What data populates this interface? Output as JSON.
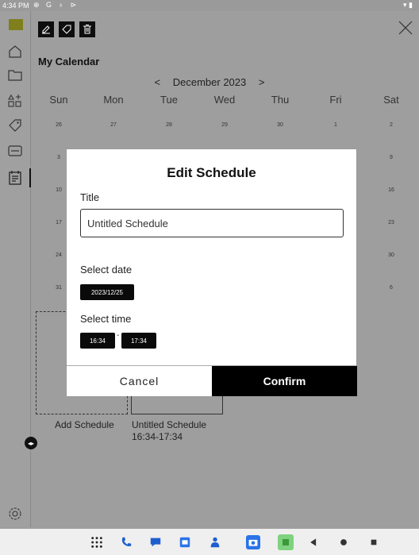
{
  "status_bar": {
    "time": "4:34 PM",
    "icons": "⊕ G ♁ ⊳",
    "right_icons": "▾ ▮"
  },
  "calendar": {
    "title": "My Calendar",
    "prev_arrow": "<",
    "month": "December 2023",
    "next_arrow": ">",
    "weekdays": [
      "Sun",
      "Mon",
      "Tue",
      "Wed",
      "Thu",
      "Fri",
      "Sat"
    ],
    "rows": [
      [
        "26",
        "27",
        "28",
        "29",
        "30",
        "1",
        "2"
      ],
      [
        "3",
        "",
        "",
        "",
        "",
        "",
        "9"
      ],
      [
        "10",
        "",
        "",
        "",
        "",
        "",
        "16"
      ],
      [
        "17",
        "",
        "",
        "",
        "",
        "",
        "23"
      ],
      [
        "24",
        "",
        "",
        "",
        "",
        "",
        "30"
      ],
      [
        "31",
        "",
        "",
        "",
        "",
        "",
        "6"
      ]
    ]
  },
  "schedule": {
    "add_label": "Add Schedule",
    "event_title": "Untitled Schedule",
    "event_time": "16:34-17:34"
  },
  "dialog": {
    "title": "Edit Schedule",
    "title_label": "Title",
    "title_value": "Untitled Schedule",
    "date_label": "Select date",
    "date_value": "2023/12/25",
    "time_label": "Select time",
    "time_start": "16:34",
    "time_sep": "-",
    "time_end": "17:34",
    "cancel": "Cancel",
    "confirm": "Confirm"
  },
  "colors": {
    "accent": "#000000",
    "overlay": "#9e9e9e",
    "logo": "#7f7f1e"
  }
}
